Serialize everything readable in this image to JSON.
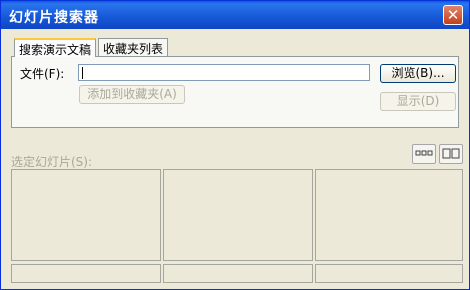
{
  "window": {
    "title": "幻灯片搜索器",
    "close_glyph": "✕"
  },
  "tabs": [
    {
      "label": "搜索演示文稿",
      "active": true
    },
    {
      "label": "收藏夹列表",
      "active": false
    }
  ],
  "search_tab": {
    "file_label": "文件(F):",
    "file_value": "",
    "browse_button": "浏览(B)...",
    "add_favorites_button": "添加到收藏夹(A)",
    "show_button": "显示(D)"
  },
  "slides": {
    "selected_label": "选定幻灯片(S):",
    "view_buttons": [
      "small-thumbnails-icon",
      "large-thumbnails-icon"
    ],
    "thumbnails": [
      "",
      "",
      "",
      "",
      "",
      ""
    ]
  },
  "colors": {
    "titlebar": "#1557d6",
    "face": "#ece9d8",
    "tab_highlight": "#ffc83c",
    "disabled_text": "#aca899"
  }
}
